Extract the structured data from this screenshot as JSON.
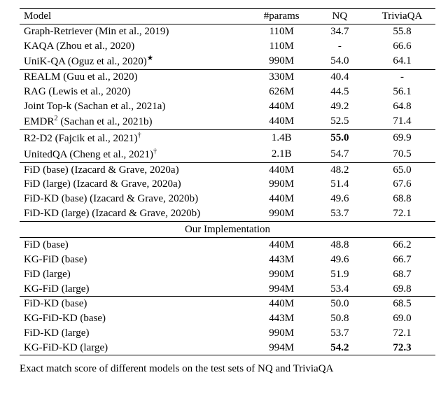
{
  "chart_data": {
    "type": "table",
    "title": "Exact match score of different models on the test sets of NQ and TriviaQA",
    "columns": [
      "Model",
      "#params",
      "NQ",
      "TriviaQA"
    ],
    "groups": [
      {
        "name": "prior-work",
        "rows": [
          {
            "model": "Graph-Retriever (Min et al., 2019)",
            "params": "110M",
            "nq": "34.7",
            "triviaqa": "55.8",
            "bold": {}
          },
          {
            "model": "KAQA (Zhou et al., 2020)",
            "params": "110M",
            "nq": "-",
            "triviaqa": "66.6",
            "bold": {}
          },
          {
            "model": "UniK-QA (Oguz et al., 2020)★",
            "params": "990M",
            "nq": "54.0",
            "triviaqa": "64.1",
            "bold": {}
          }
        ]
      },
      {
        "name": "retrieval-augmented",
        "rows": [
          {
            "model": "REALM (Guu et al., 2020)",
            "params": "330M",
            "nq": "40.4",
            "triviaqa": "-",
            "bold": {}
          },
          {
            "model": "RAG (Lewis et al., 2020)",
            "params": "626M",
            "nq": "44.5",
            "triviaqa": "56.1",
            "bold": {}
          },
          {
            "model": "Joint Top-k (Sachan et al., 2021a)",
            "params": "440M",
            "nq": "49.2",
            "triviaqa": "64.8",
            "bold": {}
          },
          {
            "model": "EMDR² (Sachan et al., 2021b)",
            "params": "440M",
            "nq": "52.5",
            "triviaqa": "71.4",
            "bold": {}
          }
        ]
      },
      {
        "name": "ensembles",
        "rows": [
          {
            "model": "R2-D2 (Fajcik et al., 2021)†",
            "params": "1.4B",
            "nq": "55.0",
            "triviaqa": "69.9",
            "bold": {
              "nq": true
            }
          },
          {
            "model": "UnitedQA (Cheng et al., 2021)†",
            "params": "2.1B",
            "nq": "54.7",
            "triviaqa": "70.5",
            "bold": {}
          }
        ]
      },
      {
        "name": "fid-reported",
        "rows": [
          {
            "model": "FiD (base) (Izacard & Grave, 2020a)",
            "params": "440M",
            "nq": "48.2",
            "triviaqa": "65.0",
            "bold": {}
          },
          {
            "model": "FiD (large) (Izacard & Grave, 2020a)",
            "params": "990M",
            "nq": "51.4",
            "triviaqa": "67.6",
            "bold": {}
          },
          {
            "model": "FiD-KD (base) (Izacard & Grave, 2020b)",
            "params": "440M",
            "nq": "49.6",
            "triviaqa": "68.8",
            "bold": {}
          },
          {
            "model": "FiD-KD (large) (Izacard & Grave, 2020b)",
            "params": "990M",
            "nq": "53.7",
            "triviaqa": "72.1",
            "bold": {}
          }
        ]
      },
      {
        "name": "our-implementation",
        "label": "Our Implementation",
        "rows": [
          {
            "model": "FiD (base)",
            "params": "440M",
            "nq": "48.8",
            "triviaqa": "66.2",
            "bold": {}
          },
          {
            "model": "KG-FiD (base)",
            "params": "443M",
            "nq": "49.6",
            "triviaqa": "66.7",
            "bold": {}
          },
          {
            "model": "FiD (large)",
            "params": "990M",
            "nq": "51.9",
            "triviaqa": "68.7",
            "bold": {}
          },
          {
            "model": "KG-FiD (large)",
            "params": "994M",
            "nq": "53.4",
            "triviaqa": "69.8",
            "bold": {}
          }
        ]
      },
      {
        "name": "our-implementation-kd",
        "rows": [
          {
            "model": "FiD-KD (base)",
            "params": "440M",
            "nq": "50.0",
            "triviaqa": "68.5",
            "bold": {}
          },
          {
            "model": "KG-FiD-KD (base)",
            "params": "443M",
            "nq": "50.8",
            "triviaqa": "69.0",
            "bold": {}
          },
          {
            "model": "FiD-KD (large)",
            "params": "990M",
            "nq": "53.7",
            "triviaqa": "72.1",
            "bold": {}
          },
          {
            "model": "KG-FiD-KD (large)",
            "params": "994M",
            "nq": "54.2",
            "triviaqa": "72.3",
            "bold": {
              "nq": true,
              "triviaqa": true
            }
          }
        ]
      }
    ]
  },
  "headers": {
    "model": "Model",
    "params": "#params",
    "nq": "NQ",
    "triviaqa": "TriviaQA"
  },
  "section_label": "Our Implementation",
  "caption_fragment": "Exact match score of different models on the test sets of NQ and TriviaQA"
}
